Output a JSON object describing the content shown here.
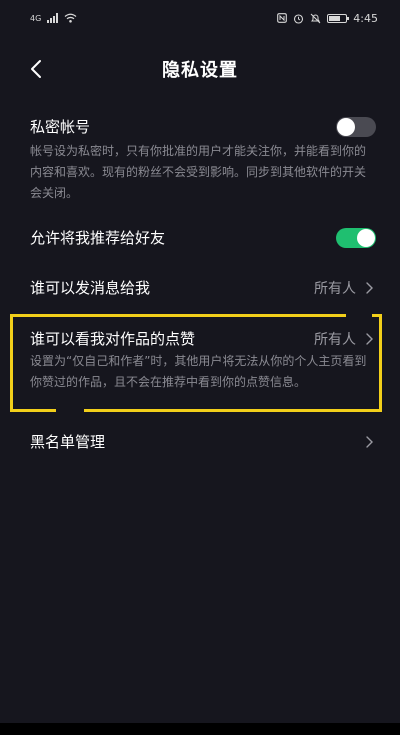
{
  "status_bar": {
    "network_label": "4G",
    "time": "4:45"
  },
  "header": {
    "title": "隐私设置"
  },
  "settings": {
    "private_account": {
      "title": "私密帐号",
      "description": "帐号设为私密时，只有你批准的用户才能关注你，并能看到你的内容和喜欢。现有的粉丝不会受到影响。同步到其他软件的开关会关闭。",
      "enabled": false
    },
    "recommend_to_friends": {
      "title": "允许将我推荐给好友",
      "enabled": true
    },
    "who_can_message": {
      "title": "谁可以发消息给我",
      "value": "所有人"
    },
    "who_can_see_likes": {
      "title": "谁可以看我对作品的点赞",
      "value": "所有人",
      "description": "设置为“仅自己和作者”时，其他用户将无法从你的个人主页看到你赞过的作品，且不会在推荐中看到你的点赞信息。"
    },
    "blacklist": {
      "title": "黑名单管理"
    }
  },
  "colors": {
    "background": "#16161e",
    "toggle_on": "#1fbf70",
    "toggle_off": "#4a4a52",
    "highlight": "#f2cf1a"
  }
}
